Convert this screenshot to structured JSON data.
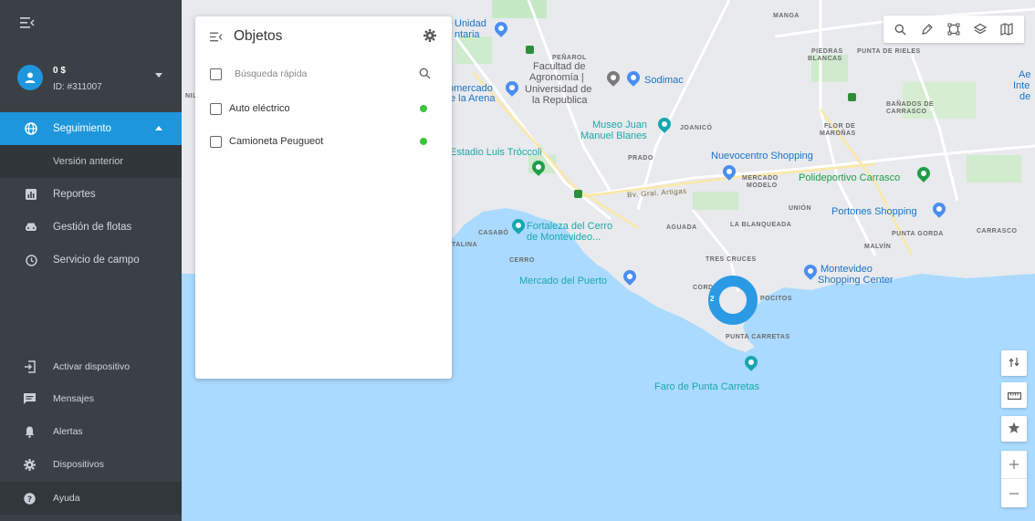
{
  "sidebar": {
    "user": {
      "balance": "0 $",
      "id": "ID: #311007"
    },
    "nav": [
      {
        "label": "Seguimiento",
        "icon": "globe-icon",
        "active": true
      },
      {
        "label": "Versión anterior",
        "icon": "",
        "sub": true
      },
      {
        "label": "Reportes",
        "icon": "chart-icon"
      },
      {
        "label": "Gestión de flotas",
        "icon": "car-icon"
      },
      {
        "label": "Servicio de campo",
        "icon": "clock-icon"
      }
    ],
    "bottom": [
      {
        "label": "Activar dispositivo",
        "icon": "login-icon"
      },
      {
        "label": "Mensajes",
        "icon": "message-icon"
      },
      {
        "label": "Alertas",
        "icon": "bell-icon"
      },
      {
        "label": "Dispositivos",
        "icon": "gear-icon"
      },
      {
        "label": "Ayuda",
        "icon": "help-icon"
      }
    ]
  },
  "panel": {
    "title": "Objetos",
    "search_placeholder": "Búsqueda rápida",
    "objects": [
      {
        "name": "Auto eléctrico",
        "status_color": "#3cc43c"
      },
      {
        "name": "Camioneta Peugueot",
        "status_color": "#3cc43c"
      }
    ]
  },
  "map": {
    "cluster_count": "2",
    "labels": {
      "manga": "MANGA",
      "piedras": "PIEDRAS",
      "blancas": "BLANCAS",
      "punta_rieles": "PUNTA DE RIELES",
      "penarol": "PEÑAROL",
      "banados1": "BAÑADOS DE",
      "banados2": "CARRASCO",
      "flor1": "FLOR DE",
      "flor2": "MAROÑAS",
      "joanico": "JOANICÓ",
      "prado": "PRADO",
      "mercado_modelo1": "MERCADO",
      "mercado_modelo2": "MODELO",
      "union": "UNIÓN",
      "casabo": "CASABÓ",
      "aguada": "AGUADA",
      "blanqueada": "LA BLANQUEADA",
      "punta_gorda": "PUNTA GORDA",
      "carrasco": "CARRASCO",
      "malvin": "MALVÍN",
      "cerro": "CERRO",
      "tres_cruces": "TRES CRUCES",
      "cord": "CORD",
      "pocitos": "POCITOS",
      "punta_carretas": "PUNTA CARRETAS",
      "talina": "TALINA",
      "av_artigas": "Bv. Gral. Artigas",
      "nil": "NIL"
    },
    "pois": {
      "unidad1": "Unidad",
      "unidad2": "ntaria",
      "facultad1": "Facultad de",
      "facultad2": "Agronomía |",
      "facultad3": "Universidad de",
      "facultad4": "la Republica",
      "mercado_arena1": "omercado",
      "mercado_arena2": "e la Arena",
      "sodimac": "Sodimac",
      "museo1": "Museo Juan",
      "museo2": "Manuel Blanes",
      "estadio": "Estadio Luis Tróccoli",
      "nuevocentro": "Nuevocentro Shopping",
      "polideportivo": "Polideportivo Carrasco",
      "portones": "Portones Shopping",
      "fortaleza1": "Fortaleza del Cerro",
      "fortaleza2": "de Montevideo...",
      "montevideo_sc1": "Montevideo",
      "montevideo_sc2": "Shopping Center",
      "mercado_puerto": "Mercado del Puerto",
      "faro": "Faro de Punta Carretas",
      "aeropuerto1": "Ae",
      "aeropuerto2": "Inte",
      "aeropuerto3": "de"
    }
  },
  "toolbar": [
    "search-icon",
    "tag-icon",
    "select-area-icon",
    "layers-icon",
    "map-icon"
  ],
  "right_controls": [
    "route-icon",
    "ruler-icon",
    "star-icon"
  ],
  "colors": {
    "accent": "#1e96dc",
    "sidebar": "#3a4046",
    "status_online": "#3cc43c",
    "cluster": "#2b9ae4"
  }
}
